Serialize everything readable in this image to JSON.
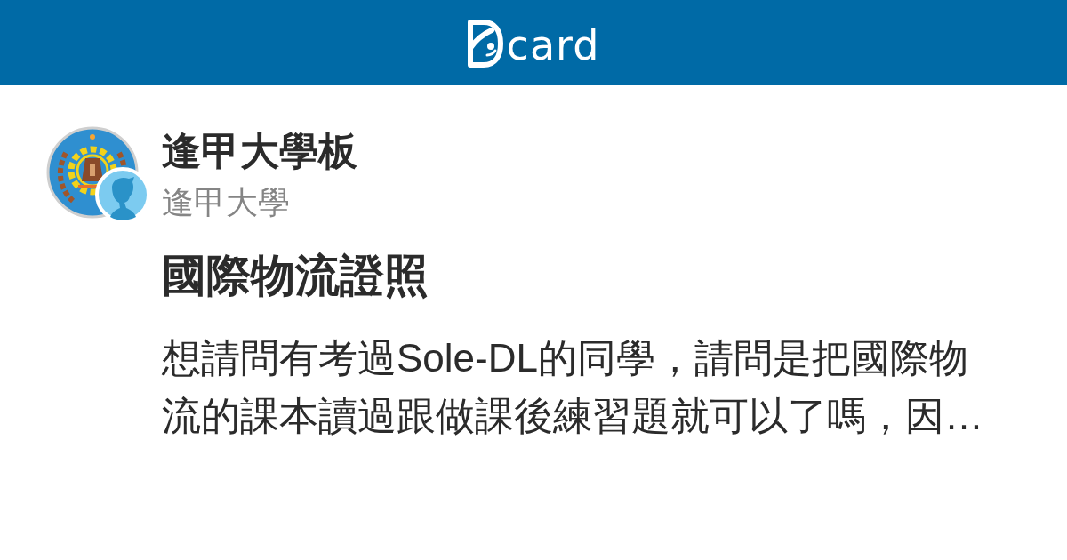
{
  "header": {
    "logo_text": "card"
  },
  "board": {
    "name": "逢甲大學板",
    "school": "逢甲大學"
  },
  "post": {
    "title": "國際物流證照",
    "excerpt": "想請問有考過Sole-DL的同學，請問是把國際物流的課本讀過跟做課後練習題就可以了嗎，因…"
  }
}
